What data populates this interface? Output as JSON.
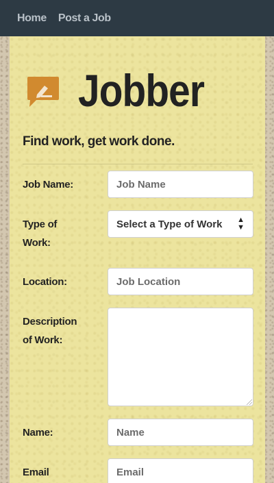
{
  "nav": {
    "home": "Home",
    "post_job": "Post a Job"
  },
  "brand": {
    "name": "Jobber",
    "tagline": "Find work, get work done.",
    "icon": "pencil-speech-icon",
    "accent_color": "#d18a2f"
  },
  "form": {
    "job_name": {
      "label": "Job Name:",
      "placeholder": "Job Name"
    },
    "type_of_work": {
      "label": "Type of Work:",
      "value": "Select a Type of Work"
    },
    "location": {
      "label": "Location:",
      "placeholder": "Job Location"
    },
    "description": {
      "label": "Description of Work:",
      "placeholder": ""
    },
    "name": {
      "label": "Name:",
      "placeholder": "Name"
    },
    "email": {
      "label": "Email",
      "placeholder": "Email"
    }
  }
}
